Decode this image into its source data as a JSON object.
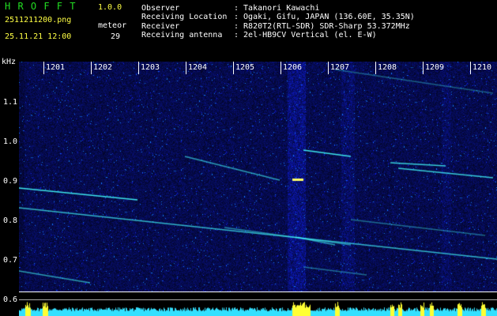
{
  "app": {
    "title": "H R O F F T",
    "version": "1.0.0"
  },
  "file": {
    "name": "2511211200.png",
    "datetime": "25.11.21 12:00"
  },
  "meteor": {
    "label": "meteor",
    "count": "29"
  },
  "info": {
    "labels": [
      "Observer",
      "Receiving Location",
      "Receiver",
      "Receiving antenna"
    ],
    "values": [
      ": Takanori Kawachi",
      ": Ogaki, Gifu, JAPAN (136.60E, 35.35N)",
      ": R820T2(RTL-SDR) SDR-Sharp 53.372MHz",
      ": 2el-HB9CV Vertical (el. E-W)"
    ]
  },
  "axis": {
    "y_unit": "kHz",
    "y_ticks": [
      "1.1",
      "1.0",
      "0.9",
      "0.8",
      "0.7",
      "0.6"
    ],
    "x_ticks": [
      "1201",
      "1202",
      "1203",
      "1204",
      "1205",
      "1206",
      "1207",
      "1208",
      "1209",
      "1210"
    ]
  },
  "colors": {
    "background": "#000000",
    "spectrum_base": "#14148c",
    "meteor_trace": "#44ffff",
    "activity_bar": "#33e0ff",
    "activity_peak": "#ffff33",
    "title": "#22dd22",
    "version": "#ffff44"
  }
}
